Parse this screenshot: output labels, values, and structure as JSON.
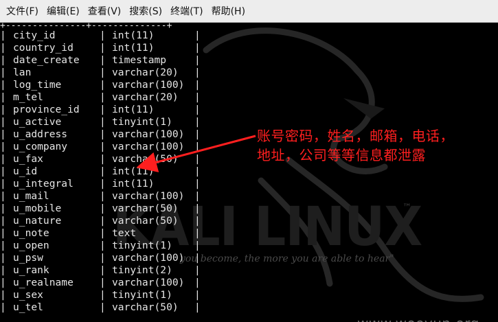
{
  "menu": {
    "items": [
      "文件(F)",
      "编辑(E)",
      "查看(V)",
      "搜索(S)",
      "终端(T)",
      "帮助(H)"
    ]
  },
  "terminal": {
    "top_border": "+---------------+--------------+",
    "rows": [
      {
        "name": "city_id",
        "type": "int(11)"
      },
      {
        "name": "country_id",
        "type": "int(11)"
      },
      {
        "name": "date_create",
        "type": "timestamp"
      },
      {
        "name": "lan",
        "type": "varchar(20)"
      },
      {
        "name": "log_time",
        "type": "varchar(100)"
      },
      {
        "name": "m_tel",
        "type": "varchar(20)"
      },
      {
        "name": "province_id",
        "type": "int(11)"
      },
      {
        "name": "u_active",
        "type": "tinyint(1)"
      },
      {
        "name": "u_address",
        "type": "varchar(100)"
      },
      {
        "name": "u_company",
        "type": "varchar(100)"
      },
      {
        "name": "u_fax",
        "type": "varchar(50)"
      },
      {
        "name": "u_id",
        "type": "int(11)"
      },
      {
        "name": "u_integral",
        "type": "int(11)"
      },
      {
        "name": "u_mail",
        "type": "varchar(100)"
      },
      {
        "name": "u_mobile",
        "type": "varchar(50)"
      },
      {
        "name": "u_nature",
        "type": "varchar(50)"
      },
      {
        "name": "u_note",
        "type": "text"
      },
      {
        "name": "u_open",
        "type": "tinyint(1)"
      },
      {
        "name": "u_psw",
        "type": "varchar(100)"
      },
      {
        "name": "u_rank",
        "type": "tinyint(2)"
      },
      {
        "name": "u_realname",
        "type": "varchar(100)"
      },
      {
        "name": "u_sex",
        "type": "tinyint(1)"
      },
      {
        "name": "u_tel",
        "type": "varchar(50)"
      }
    ]
  },
  "background": {
    "logo": "KALI LINUX",
    "tm": "™",
    "quote": "you become, the more you are able to hear\""
  },
  "annotation": {
    "line1": "账号密码，姓名，邮箱，电话，",
    "line2": "地址，公司等等信息都泄露"
  },
  "watermark": "www.wooyun.org",
  "colors": {
    "annotation": "#ff1f1f",
    "terminal_bg": "#000000",
    "terminal_fg": "#e6e6e6",
    "menubar_bg": "#ededed"
  }
}
